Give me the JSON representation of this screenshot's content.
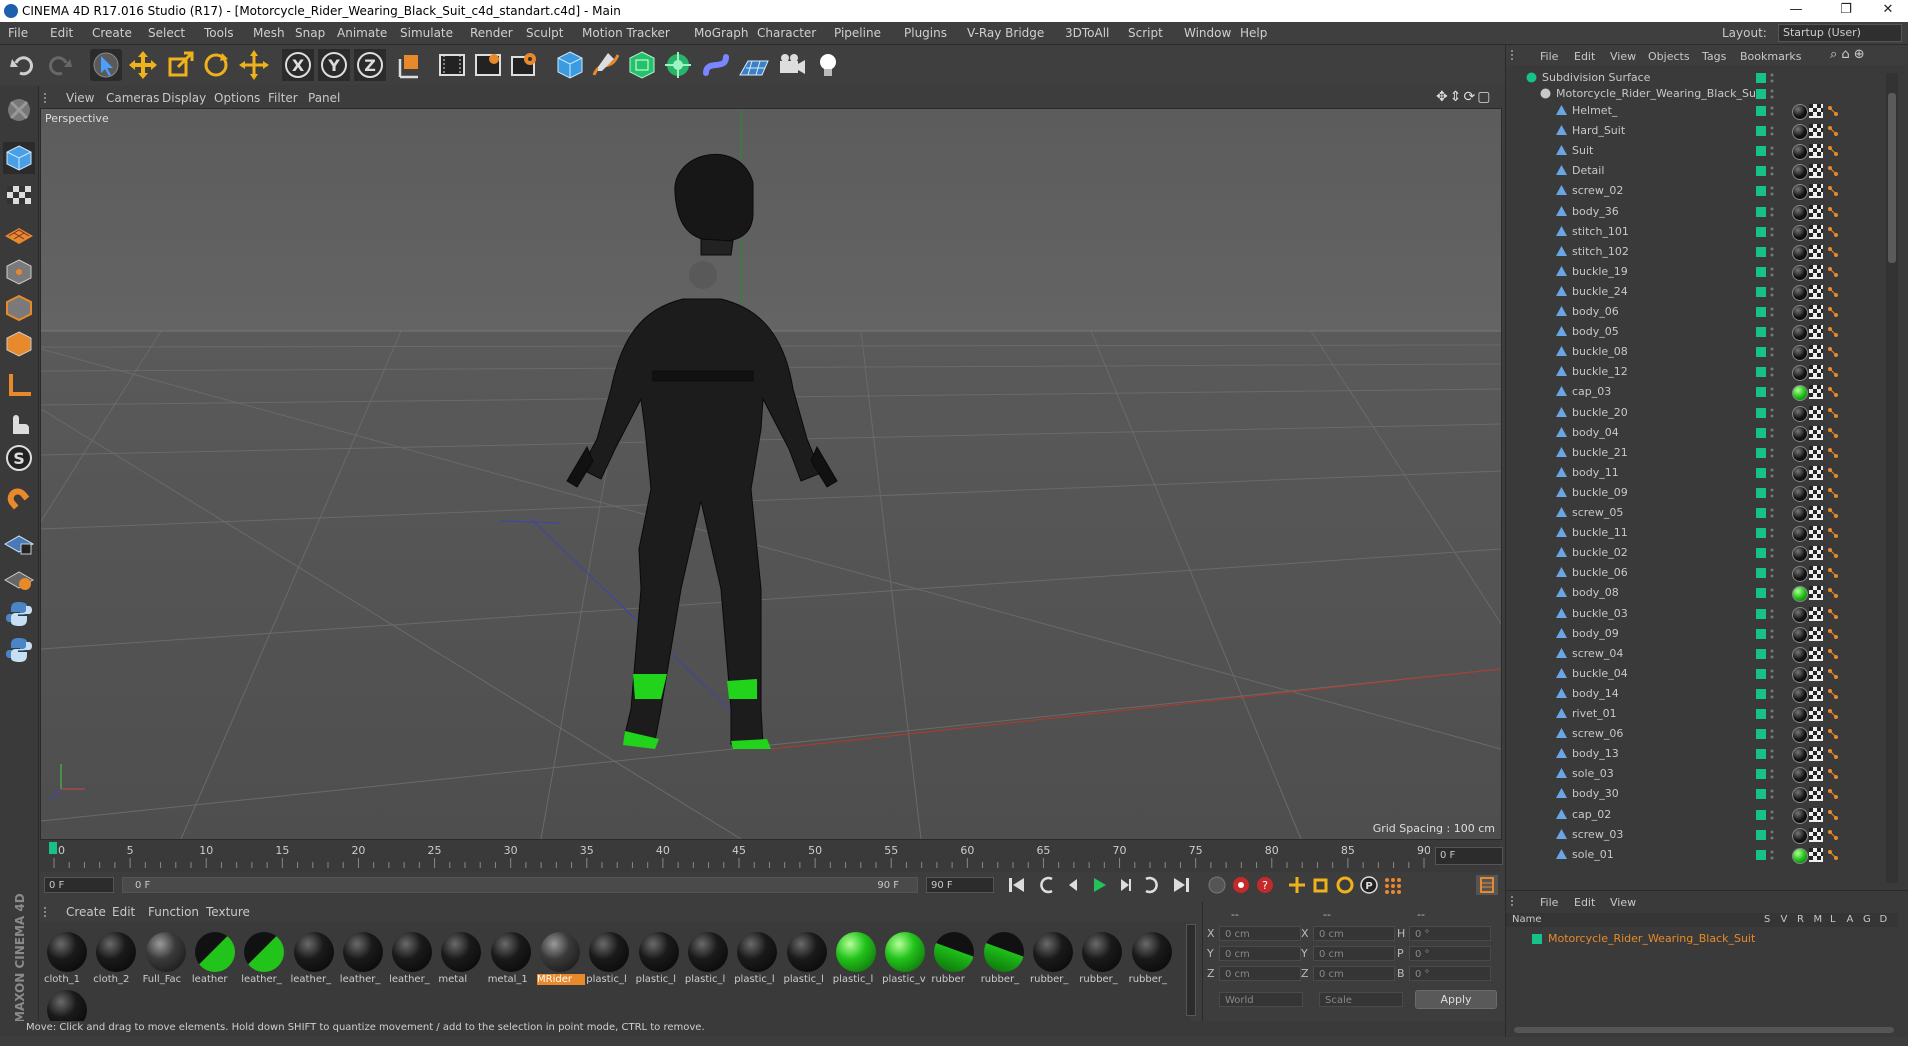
{
  "window": {
    "title": "CINEMA 4D R17.016 Studio (R17) - [Motorcycle_Rider_Wearing_Black_Suit_c4d_standart.c4d] - Main",
    "controls": [
      "—",
      "❐",
      "✕"
    ]
  },
  "menubar": {
    "items": [
      "File",
      "Edit",
      "Create",
      "Select",
      "Tools",
      "Mesh",
      "Snap",
      "Animate",
      "Simulate",
      "Render",
      "Sculpt",
      "Motion Tracker",
      "MoGraph",
      "Character",
      "Pipeline",
      "Plugins",
      "V-Ray Bridge",
      "3DToAll",
      "Script",
      "Window",
      "Help"
    ],
    "layout_label": "Layout:",
    "layout_value": "Startup (User)"
  },
  "toolbar": {
    "icons": [
      "undo-icon",
      "redo-icon",
      "select-arrow-icon",
      "move-icon",
      "scale-icon",
      "rotate-icon",
      "live-move-icon",
      "x-axis-icon",
      "y-axis-icon",
      "z-axis-icon",
      "coordinate-system-icon",
      "render-view-icon",
      "render-picture-viewer-icon",
      "render-settings-icon",
      "cube-icon",
      "pen-spline-icon",
      "subdivision-icon",
      "mograph-cloner-icon",
      "deformer-icon",
      "floor-grid-icon",
      "camera-icon",
      "light-icon"
    ]
  },
  "viewport": {
    "menu": [
      "View",
      "Cameras",
      "Display",
      "Options",
      "Filter",
      "Panel"
    ],
    "label": "Perspective",
    "grid_spacing": "Grid Spacing : 100 cm"
  },
  "timeline": {
    "ticks": [
      "0",
      "5",
      "10",
      "15",
      "20",
      "25",
      "30",
      "35",
      "40",
      "45",
      "50",
      "55",
      "60",
      "65",
      "70",
      "75",
      "80",
      "85",
      "90"
    ],
    "current_frame": "0 F",
    "start_field": "0 F",
    "range_start": "0 F",
    "range_end": "90 F",
    "end_field": "90 F"
  },
  "materials": {
    "menu": [
      "Create",
      "Edit",
      "Function",
      "Texture"
    ],
    "items": [
      {
        "label": "cloth_1",
        "kind": "black"
      },
      {
        "label": "cloth_2",
        "kind": "black"
      },
      {
        "label": "Full_Fac",
        "kind": "textured"
      },
      {
        "label": "leather",
        "kind": "black-green"
      },
      {
        "label": "leather_",
        "kind": "black-green"
      },
      {
        "label": "leather_",
        "kind": "black"
      },
      {
        "label": "leather_",
        "kind": "black"
      },
      {
        "label": "leather_",
        "kind": "black"
      },
      {
        "label": "metal",
        "kind": "black"
      },
      {
        "label": "metal_1",
        "kind": "black"
      },
      {
        "label": "MRider",
        "kind": "textured",
        "selected": true
      },
      {
        "label": "plastic_l",
        "kind": "black"
      },
      {
        "label": "plastic_l",
        "kind": "black"
      },
      {
        "label": "plastic_l",
        "kind": "black"
      },
      {
        "label": "plastic_l",
        "kind": "black"
      },
      {
        "label": "plastic_l",
        "kind": "black"
      },
      {
        "label": "plastic_l",
        "kind": "green"
      },
      {
        "label": "plastic_v",
        "kind": "green"
      },
      {
        "label": "rubber",
        "kind": "half-green"
      },
      {
        "label": "rubber_",
        "kind": "half-green"
      },
      {
        "label": "rubber_",
        "kind": "black"
      },
      {
        "label": "rubber_",
        "kind": "black"
      },
      {
        "label": "rubber_",
        "kind": "black"
      },
      {
        "label": "",
        "kind": "black"
      }
    ]
  },
  "coordinates": {
    "headers": [
      "--",
      "--",
      "--"
    ],
    "rows": [
      {
        "a": "X",
        "av": "0 cm",
        "b": "X",
        "bv": "0 cm",
        "c": "H",
        "cv": "0 °"
      },
      {
        "a": "Y",
        "av": "0 cm",
        "b": "Y",
        "bv": "0 cm",
        "c": "P",
        "cv": "0 °"
      },
      {
        "a": "Z",
        "av": "0 cm",
        "b": "Z",
        "bv": "0 cm",
        "c": "B",
        "cv": "0 °"
      }
    ],
    "world": "World",
    "scale": "Scale",
    "apply": "Apply"
  },
  "objects": {
    "menu": [
      "File",
      "Edit",
      "View",
      "Objects",
      "Tags",
      "Bookmarks"
    ],
    "root": "Subdivision Surface",
    "group": "Motorcycle_Rider_Wearing_Black_Suit",
    "children": [
      {
        "name": "Helmet_",
        "tag": "dark"
      },
      {
        "name": "Hard_Suit",
        "tag": "dark"
      },
      {
        "name": "Suit",
        "tag": "dark"
      },
      {
        "name": "Detail",
        "tag": "dark"
      },
      {
        "name": "screw_02",
        "tag": "dark"
      },
      {
        "name": "body_36",
        "tag": "dark"
      },
      {
        "name": "stitch_101",
        "tag": "dark"
      },
      {
        "name": "stitch_102",
        "tag": "dark"
      },
      {
        "name": "buckle_19",
        "tag": "dark"
      },
      {
        "name": "buckle_24",
        "tag": "dark"
      },
      {
        "name": "body_06",
        "tag": "dark"
      },
      {
        "name": "body_05",
        "tag": "dark"
      },
      {
        "name": "buckle_08",
        "tag": "dark"
      },
      {
        "name": "buckle_12",
        "tag": "dark"
      },
      {
        "name": "cap_03",
        "tag": "green"
      },
      {
        "name": "buckle_20",
        "tag": "dark"
      },
      {
        "name": "body_04",
        "tag": "dark"
      },
      {
        "name": "buckle_21",
        "tag": "dark"
      },
      {
        "name": "body_11",
        "tag": "dark"
      },
      {
        "name": "buckle_09",
        "tag": "dark"
      },
      {
        "name": "screw_05",
        "tag": "dark"
      },
      {
        "name": "buckle_11",
        "tag": "dark"
      },
      {
        "name": "buckle_02",
        "tag": "dark"
      },
      {
        "name": "buckle_06",
        "tag": "dark"
      },
      {
        "name": "body_08",
        "tag": "green"
      },
      {
        "name": "buckle_03",
        "tag": "dark"
      },
      {
        "name": "body_09",
        "tag": "dark"
      },
      {
        "name": "screw_04",
        "tag": "dark"
      },
      {
        "name": "buckle_04",
        "tag": "dark"
      },
      {
        "name": "body_14",
        "tag": "dark"
      },
      {
        "name": "rivet_01",
        "tag": "dark"
      },
      {
        "name": "screw_06",
        "tag": "dark"
      },
      {
        "name": "body_13",
        "tag": "dark"
      },
      {
        "name": "sole_03",
        "tag": "dark"
      },
      {
        "name": "body_30",
        "tag": "dark"
      },
      {
        "name": "cap_02",
        "tag": "dark"
      },
      {
        "name": "screw_03",
        "tag": "dark"
      },
      {
        "name": "sole_01",
        "tag": "green"
      }
    ]
  },
  "layers": {
    "menu": [
      "File",
      "Edit",
      "View"
    ],
    "columns": [
      "Name",
      "S",
      "V",
      "R",
      "M",
      "L",
      "A",
      "G",
      "D"
    ],
    "item": "Motorcycle_Rider_Wearing_Black_Suit"
  },
  "status": "Move: Click and drag to move elements. Hold down SHIFT to quantize movement / add to the selection in point mode, CTRL to remove.",
  "brand": "MAXON CINEMA 4D",
  "colors": {
    "accent": "#17c28a",
    "orange": "#e8892b",
    "green": "#22d31b"
  }
}
